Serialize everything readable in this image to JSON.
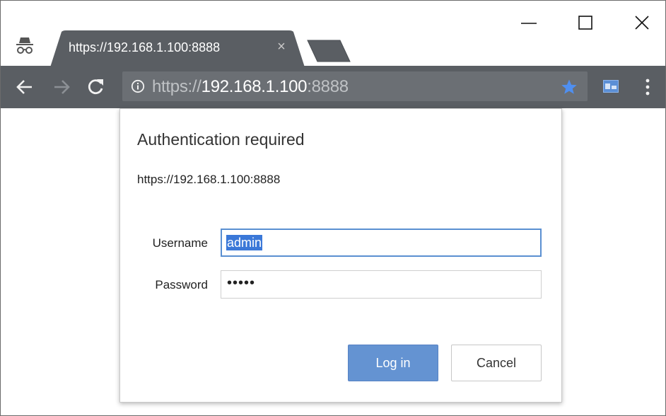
{
  "browser": {
    "tab": {
      "title": "https://192.168.1.100:8888",
      "close_glyph": "×"
    },
    "omnibox": {
      "scheme": "https://",
      "host": "192.168.1.100",
      "port": ":8888"
    },
    "incognito_icon": "incognito-icon",
    "colors": {
      "toolbar": "#5a5e63",
      "omnibox": "#6b6f74",
      "star": "#4f8ff0"
    }
  },
  "dialog": {
    "title": "Authentication required",
    "origin": "https://192.168.1.100:8888",
    "username_label": "Username",
    "username_value": "admin",
    "password_label": "Password",
    "password_dots": "•••••",
    "login_label": "Log in",
    "cancel_label": "Cancel",
    "colors": {
      "primary_button": "#6493d2",
      "focus_border": "#5a8fd1",
      "selection": "#3b78d8"
    }
  }
}
